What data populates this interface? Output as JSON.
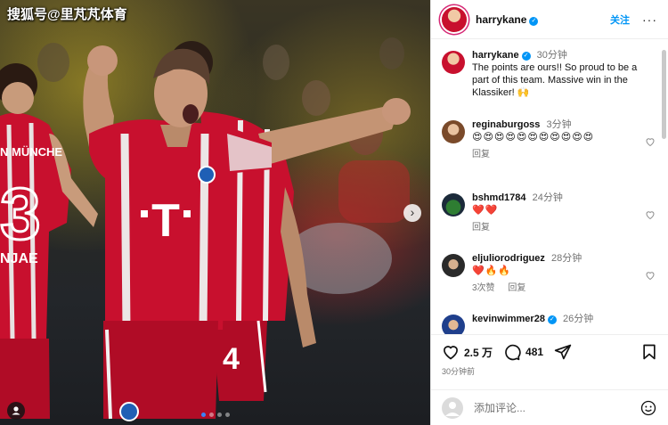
{
  "photo": {
    "watermark": "搜狐号@里芃芃体育",
    "jersey_name_left": "N MÜNCHE",
    "jersey_name_left_2": "NJAE",
    "jersey_number_left": "3",
    "jersey_number_right": "4",
    "dots_total": 4,
    "dot_active": 0
  },
  "header": {
    "username": "harrykane",
    "follow_label": "关注",
    "more_label": "···"
  },
  "caption": {
    "username": "harrykane",
    "time": "30分钟",
    "text": "The points are ours!! So proud to be a part of this team. Massive win in the Klassiker! 🙌"
  },
  "comments": [
    {
      "username": "reginaburgoss",
      "time": "3分钟",
      "text": "😍😍😍😍😍😍😍😍😍😍😍",
      "reply_label": "回复",
      "likes_label": ""
    },
    {
      "username": "bshmd1784",
      "time": "24分钟",
      "text": "❤️❤️",
      "reply_label": "回复",
      "likes_label": ""
    },
    {
      "username": "eljuliorodriguez",
      "time": "28分钟",
      "text": "❤️🔥🔥",
      "reply_label": "回复",
      "likes_label": "3次赞"
    },
    {
      "username": "kevinwimmer28",
      "time": "26分钟",
      "text": "",
      "reply_label": "",
      "likes_label": ""
    }
  ],
  "actions": {
    "likes": "2.5 万",
    "comments": "481",
    "posted": "30分钟前"
  },
  "add_comment": {
    "placeholder": "添加评论..."
  },
  "colors": {
    "accent": "#0095f6",
    "jersey_red": "#c8102e",
    "story_ring": "#d62976"
  }
}
